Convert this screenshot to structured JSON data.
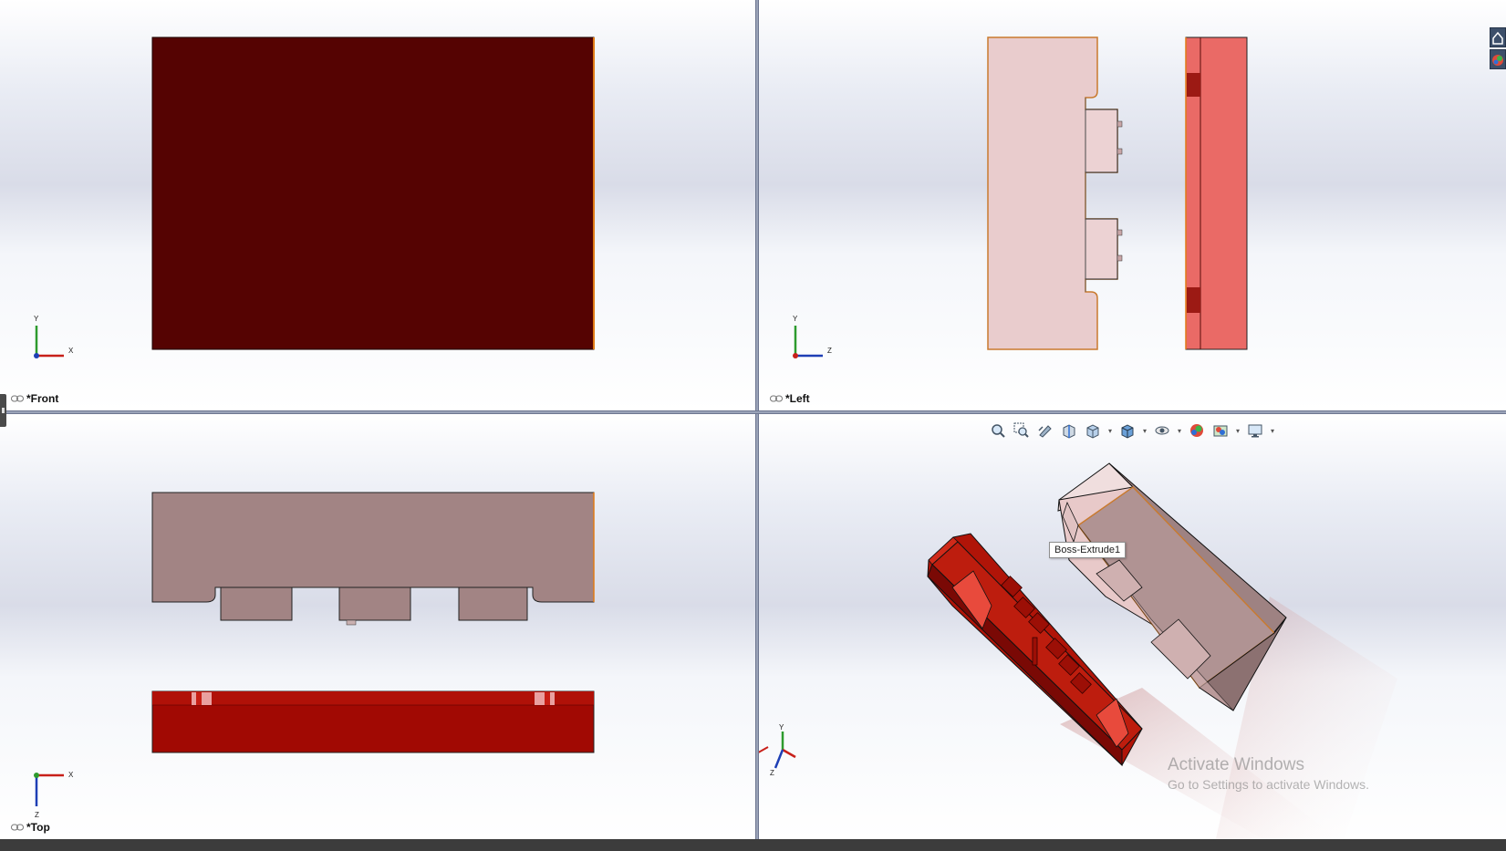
{
  "views": {
    "front": {
      "label": "*Front",
      "triad": {
        "up": "Y",
        "right": "X"
      }
    },
    "left": {
      "label": "*Left",
      "triad": {
        "up": "Y",
        "right": "Z"
      }
    },
    "top": {
      "label": "*Top",
      "triad": {
        "down": "Z",
        "right": "X"
      }
    },
    "iso": {
      "label": "",
      "triad": {
        "up": "Y",
        "right": "X",
        "down": "Z"
      }
    }
  },
  "tooltip": {
    "text": "Boss-Extrude1"
  },
  "heads_up_toolbar": [
    {
      "name": "zoom-to-fit-icon"
    },
    {
      "name": "zoom-to-area-icon"
    },
    {
      "name": "previous-view-icon"
    },
    {
      "name": "section-view-icon"
    },
    {
      "name": "view-orientation-icon",
      "dropdown": true
    },
    {
      "name": "display-style-icon",
      "dropdown": true
    },
    {
      "name": "hide-show-items-icon",
      "dropdown": true
    },
    {
      "name": "edit-appearance-icon"
    },
    {
      "name": "apply-scene-icon",
      "dropdown": true
    },
    {
      "name": "view-settings-icon",
      "dropdown": true
    }
  ],
  "task_pane": [
    {
      "name": "home-icon"
    },
    {
      "name": "appearances-icon"
    }
  ],
  "watermark": {
    "title": "Activate Windows",
    "subtitle": "Go to Settings to activate Windows."
  },
  "colors": {
    "core_dark": "#550302",
    "core_red": "#a10903",
    "cavity_pink": "#e9cccd",
    "cavity_mauve": "#a28484",
    "edge_highlight": "#e07b16",
    "viewport_separator": "#9aa3b8"
  }
}
